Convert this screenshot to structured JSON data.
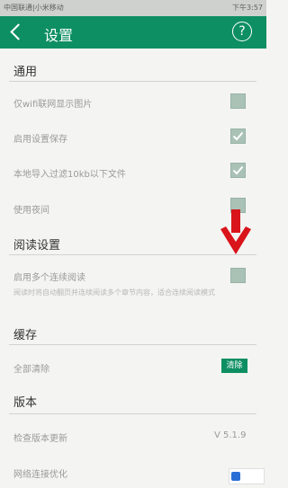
{
  "status_bar": {
    "carriers": "中国联通|小米移动",
    "clock": "下午3:57"
  },
  "app_bar": {
    "title": "设置",
    "help_glyph": "?",
    "background": "#0e8f63"
  },
  "sections": {
    "general": "通用",
    "reading": "阅读设置",
    "cache": "缓存",
    "version": "版本"
  },
  "general_items": [
    {
      "label": "仅wifi联网显示图片",
      "checked": false
    },
    {
      "label": "启用设置保存",
      "checked": true
    },
    {
      "label": "本地导入过滤10kb以下文件",
      "checked": true
    },
    {
      "label": "使用夜间",
      "checked": false
    }
  ],
  "reading_item": {
    "label": "启用多个连续阅读",
    "checked": false,
    "description": "阅读时将自动翻页并连续阅读多个章节内容，适合连续阅读模式"
  },
  "cache": {
    "label": "全部清除",
    "button_label": "清除"
  },
  "version": {
    "check_label": "检查版本更新",
    "value": "V 5.1.9",
    "optimize_label": "网络连接优化"
  },
  "colors": {
    "accent": "#0e8f63",
    "checkbox": "#a9c2b5",
    "annotation_arrow": "#d9141b"
  },
  "icons": {
    "back": "chevron-left-icon",
    "help": "question-circle-icon",
    "check": "checkmark-icon",
    "annotation": "red-down-arrow-icon"
  }
}
